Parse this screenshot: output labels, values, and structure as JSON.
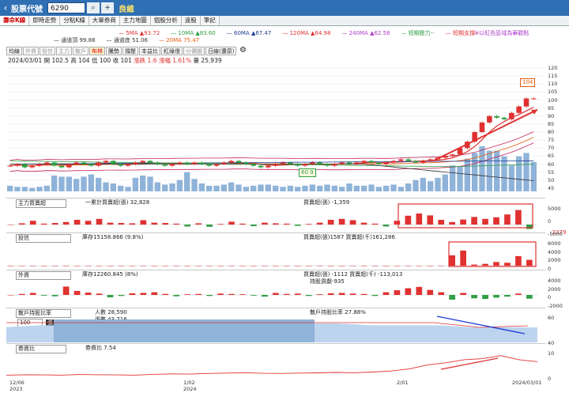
{
  "topbar": {
    "back_glyph": "‹",
    "title": "股票代號",
    "code": "6290",
    "search_icon": "search-icon",
    "add_icon": "add-icon",
    "name": "良維"
  },
  "tabs": [
    "壽命K線",
    "即時走勢",
    "分點K線",
    "大單券商",
    "主力地圖",
    "個股分析",
    "遠股",
    "筆記"
  ],
  "ma_legend": [
    {
      "label": "5MA ▲93.72",
      "color": "#e03131"
    },
    {
      "label": "10MA ▲83.60",
      "color": "#2f9e44"
    },
    {
      "label": "60MA ▲67.47",
      "color": "#1c3d8f"
    },
    {
      "label": "120MA ▲64.98",
      "color": "#e03131"
    },
    {
      "label": "240MA ▲62.58",
      "color": "#ae3ec9"
    },
    {
      "label": "短期壓力--",
      "color": "#2f9e44"
    },
    {
      "label": "短期支撐--",
      "color": "#e03131"
    }
  ],
  "ma_legend2": [
    {
      "label": "通道頂 99.88",
      "color": "#333"
    },
    {
      "label": "通道底 51.06",
      "color": "#333"
    },
    {
      "label": "20MA 75.47",
      "color": "#e8590c"
    }
  ],
  "hint": "①以紅色區域為華觀點",
  "subtabs": [
    {
      "label": "均線",
      "dim": false
    },
    {
      "label": "外資",
      "dim": true
    },
    {
      "label": "投信",
      "dim": true
    },
    {
      "label": "主力",
      "dim": true
    },
    {
      "label": "散戶",
      "dim": true
    },
    {
      "label": "布林",
      "dim": false,
      "active": true
    },
    {
      "label": "騰勢",
      "dim": false
    },
    {
      "label": "撐壓",
      "dim": false
    },
    {
      "label": "本益比",
      "dim": false
    },
    {
      "label": "紅綠燈",
      "dim": false
    },
    {
      "label": "分價圖",
      "dim": true
    },
    {
      "label": "日線(還原)",
      "dim": false
    }
  ],
  "ohlc": {
    "date": "2024/03/01",
    "open": "開 102.5",
    "high": "高 104",
    "low": "低 100",
    "close": "收 101",
    "change": "漲跌 1.6",
    "pct": "漲幅 1.61%",
    "volume": "量 25,939"
  },
  "price_axis": [
    "120",
    "115",
    "110",
    "105",
    "100",
    "95",
    "90",
    "85",
    "80",
    "75",
    "70",
    "65",
    "60",
    "55",
    "50",
    "45"
  ],
  "price_tags": {
    "high": "104",
    "low": "60.9"
  },
  "panels": {
    "main_force": {
      "select": "主力買賣超",
      "text1": "一累計買賣超(張) 32,828",
      "text2": "買賣超(張) -1,359",
      "axis": [
        "5000",
        "0",
        "-5000"
      ],
      "right_value": "-2379"
    },
    "trust": {
      "select": "投信",
      "text1": "庫存15158.866 (9.8%)",
      "text2": "買賣超(張)1587 買賣超(千)161,286",
      "axis": [
        "6000",
        "4000",
        "2000",
        "0"
      ]
    },
    "foreign": {
      "select": "外資",
      "text1": "庫存12260.845 (8%)",
      "text2": "買賣超(張) -1112 買賣超(千) -113,013",
      "text3": "持股貢獻-935",
      "axis": [
        "4000",
        "2000",
        "0",
        "-2000"
      ]
    },
    "retail": {
      "select": "散戶持股比率",
      "sub": "100",
      "sub2": "張以下",
      "text1": "人數 28,590",
      "text2": "張數 43,716",
      "text3": "散戶持股比率 27.88%",
      "axis": [
        "60",
        "40"
      ]
    },
    "margin": {
      "select": "券資比",
      "text1": "券資比 7.54",
      "axis": [
        "10",
        "0"
      ]
    }
  },
  "x_axis": [
    {
      "label": "12/06",
      "sub": "2023"
    },
    {
      "label": "1/02",
      "sub": "2024"
    },
    {
      "label": "2/01",
      "sub": ""
    },
    {
      "label": "2024/03/01",
      "sub": ""
    }
  ],
  "chart_data": {
    "type": "candlestick",
    "title": "",
    "closes": [
      59,
      60,
      58,
      59,
      60,
      61,
      59,
      58,
      60,
      61,
      60,
      59,
      61,
      62,
      60,
      59,
      60,
      61,
      62,
      61,
      60,
      59,
      60,
      61,
      60,
      61,
      60,
      59,
      60,
      61,
      62,
      61,
      60,
      59,
      58,
      59,
      60,
      61,
      60,
      59,
      60,
      61,
      60,
      59,
      60,
      61,
      60,
      61,
      62,
      61,
      60,
      61,
      62,
      63,
      62,
      61,
      62,
      63,
      64,
      65,
      66,
      70,
      74,
      80,
      86,
      90,
      89,
      88,
      92,
      96,
      101,
      101
    ],
    "volumes": [
      5,
      4,
      4,
      3,
      4,
      5,
      14,
      13,
      13,
      11,
      13,
      15,
      12,
      8,
      7,
      5,
      4,
      12,
      14,
      13,
      8,
      6,
      7,
      10,
      17,
      11,
      7,
      5,
      5,
      6,
      8,
      6,
      4,
      5,
      6,
      6,
      5,
      4,
      5,
      4,
      5,
      6,
      5,
      6,
      5,
      4,
      7,
      5,
      5,
      6,
      4,
      5,
      6,
      4,
      7,
      10,
      12,
      9,
      12,
      15,
      23,
      22,
      29,
      34,
      40,
      36,
      36,
      31,
      23,
      31,
      34,
      26
    ],
    "main_force_net": [
      0,
      400,
      1200,
      300,
      500,
      800,
      1500,
      1200,
      1800,
      600,
      500,
      400,
      1400,
      600,
      500,
      300,
      -600,
      400,
      -700,
      200,
      900,
      300,
      -500,
      600,
      400,
      300,
      -400,
      200,
      600,
      1500,
      1800,
      1400,
      600,
      300,
      -600,
      1200,
      2800,
      3500,
      2900,
      1500,
      800,
      1600,
      2400,
      1800,
      2300,
      3200,
      4600,
      -1400
    ],
    "trust_net": [
      0,
      0,
      0,
      0,
      0,
      0,
      0,
      0,
      0,
      0,
      0,
      0,
      0,
      0,
      0,
      0,
      0,
      0,
      0,
      0,
      0,
      0,
      0,
      0,
      0,
      0,
      0,
      0,
      0,
      0,
      0,
      0,
      0,
      0,
      0,
      0,
      0,
      0,
      0,
      0,
      2800,
      4100,
      300,
      500,
      1000,
      800,
      2600,
      1587
    ],
    "foreign_net": [
      0,
      300,
      600,
      -200,
      -400,
      2500,
      1200,
      700,
      400,
      -700,
      -300,
      500,
      600,
      800,
      300,
      -400,
      200,
      300,
      -300,
      400,
      300,
      200,
      -200,
      -500,
      600,
      300,
      400,
      -300,
      200,
      500,
      600,
      400,
      300,
      -300,
      800,
      1400,
      2000,
      2400,
      1500,
      800,
      -1400,
      600,
      -1000,
      -1200,
      -800,
      -500,
      400,
      -1112
    ],
    "retail_pct": [
      28,
      29,
      29,
      30,
      31,
      31,
      31,
      30,
      30,
      30,
      30,
      29,
      29,
      29,
      28,
      28,
      27.88
    ],
    "margin_ratio": [
      1,
      1.2,
      1.1,
      1,
      1.3,
      1.2,
      1.1,
      1,
      1.4,
      1.6,
      1.5,
      1.8,
      2,
      2.2,
      1.9,
      1.8,
      2,
      2.1,
      2.3,
      2.2,
      2.5,
      3,
      4,
      6,
      7,
      8.5,
      9,
      10.5,
      8.5,
      7.54
    ]
  }
}
